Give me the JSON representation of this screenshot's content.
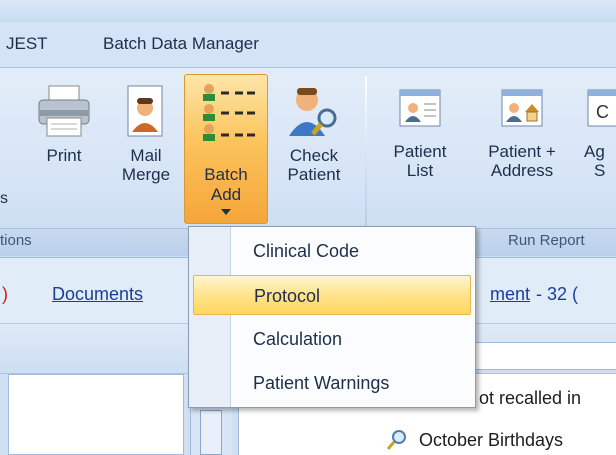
{
  "tabs": [
    "JEST",
    "Batch Data Manager"
  ],
  "ribbon": {
    "buttons": [
      {
        "label_line1": "Print",
        "label_line2": ""
      },
      {
        "label_line1": "Mail",
        "label_line2": "Merge"
      },
      {
        "label_line1": "Batch",
        "label_line2": "Add"
      },
      {
        "label_line1": "Check",
        "label_line2": "Patient"
      },
      {
        "label_line1": "Patient",
        "label_line2": "List"
      },
      {
        "label_line1": "Patient +",
        "label_line2": "Address"
      },
      {
        "label_line1": "Ag",
        "label_line2": "S"
      }
    ],
    "left_cut_label": "s",
    "group_left": "tions",
    "group_right": "Run Report"
  },
  "links": {
    "paren_left": ")",
    "documents": "Documents",
    "document_link": "ment",
    "count_text": " - 32 (",
    "count_paren": "("
  },
  "dropdown": {
    "items": [
      "Clinical Code",
      "Protocol",
      "Calculation",
      "Patient Warnings"
    ],
    "highlighted_index": 1
  },
  "list": {
    "row1": "ot recalled in",
    "row2": "October Birthdays"
  }
}
